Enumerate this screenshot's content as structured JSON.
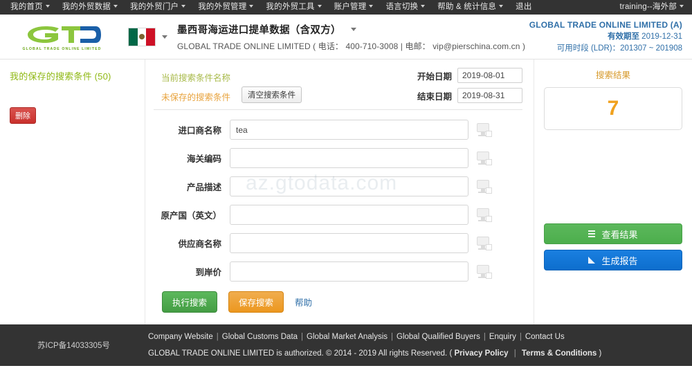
{
  "topnav": {
    "items": [
      {
        "label": "我的首页",
        "caret": true
      },
      {
        "label": "我的外贸数据",
        "caret": true
      },
      {
        "label": "我的外贸门户",
        "caret": true
      },
      {
        "label": "我的外贸管理",
        "caret": true
      },
      {
        "label": "我的外贸工具",
        "caret": true
      },
      {
        "label": "账户管理",
        "caret": true
      },
      {
        "label": "语言切换",
        "caret": true
      },
      {
        "label": "帮助 & 统计信息",
        "caret": true
      },
      {
        "label": "退出",
        "caret": false
      }
    ],
    "user": "training--海外部"
  },
  "header": {
    "logo_tagline": "GLOBAL TRADE ONLINE LIMITED",
    "flag_country": "mexico",
    "title": "墨西哥海运进口提单数据（含双方）",
    "subtitle": "GLOBAL TRADE ONLINE LIMITED ( 电话： 400-710-3008 | 电邮： vip@pierschina.com.cn )",
    "account_name": "GLOBAL TRADE ONLINE LIMITED (A)",
    "expiry_label": "有效期至",
    "expiry_value": "2019-12-31",
    "ldr_text": "可用时段 (LDR)：201307 ~ 201908"
  },
  "sidebar": {
    "saved_title": "我的保存的搜索条件 (50)",
    "delete_label": "删除"
  },
  "search_panel": {
    "current_condition_label": "当前搜索条件名称",
    "unsaved_label": "未保存的搜索条件",
    "clear_button": "清空搜索条件",
    "start_date_label": "开始日期",
    "start_date_value": "2019-08-01",
    "end_date_label": "结束日期",
    "end_date_value": "2019-08-31",
    "fields": [
      {
        "label": "进口商名称",
        "value": "tea",
        "name": "importer-name"
      },
      {
        "label": "海关编码",
        "value": "",
        "name": "hs-code"
      },
      {
        "label": "产品描述",
        "value": "",
        "name": "product-description"
      },
      {
        "label": "原产国（英文）",
        "value": "",
        "name": "origin-country"
      },
      {
        "label": "供应商名称",
        "value": "",
        "name": "supplier-name"
      },
      {
        "label": "到岸价",
        "value": "",
        "name": "cif-price"
      }
    ],
    "exec_search": "执行搜索",
    "save_search": "保存搜索",
    "help": "帮助"
  },
  "results": {
    "title": "搜索结果",
    "count": "7",
    "view_results": "查看结果",
    "generate_report": "生成报告"
  },
  "watermark": "az.gtodata.com",
  "footer": {
    "icp": "苏ICP备14033305号",
    "links": [
      "Company Website",
      "Global Customs Data",
      "Global Market Analysis",
      "Global Qualified Buyers",
      "Enquiry",
      "Contact Us"
    ],
    "copyright": "GLOBAL TRADE ONLINE LIMITED is authorized. © 2014 - 2019 All rights Reserved.",
    "open_paren": "(",
    "privacy": "Privacy Policy",
    "terms": "Terms & Conditions",
    "close_paren": ")"
  },
  "colors": {
    "nav_bg": "#333333",
    "brand_green": "#8fb814",
    "accent_orange": "#f0a11e",
    "link_blue": "#2f6fa8"
  }
}
